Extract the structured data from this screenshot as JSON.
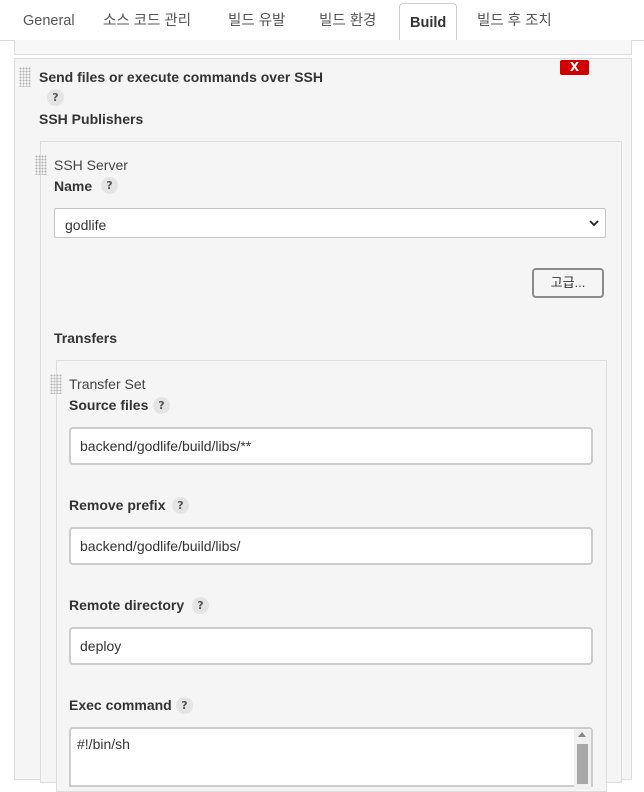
{
  "tabs": [
    {
      "label": "General",
      "active": false
    },
    {
      "label": "소스 코드 관리",
      "active": false
    },
    {
      "label": "빌드 유발",
      "active": false
    },
    {
      "label": "빌드 환경",
      "active": false
    },
    {
      "label": "Build",
      "active": true
    },
    {
      "label": "빌드 후 조치",
      "active": false
    }
  ],
  "builder": {
    "title": "Send files or execute commands over SSH",
    "delete_label": "X",
    "help_label": "?",
    "publishers_label": "SSH Publishers"
  },
  "server": {
    "section_label": "SSH Server",
    "name_label": "Name",
    "name_value": "godlife",
    "advanced_button": "고급...",
    "transfers_label": "Transfers"
  },
  "transfer_set": {
    "section_label": "Transfer Set",
    "source_files_label": "Source files",
    "source_files_value": "backend/godlife/build/libs/**",
    "remove_prefix_label": "Remove prefix",
    "remove_prefix_value": "backend/godlife/build/libs/",
    "remote_directory_label": "Remote directory",
    "remote_directory_value": "deploy",
    "exec_command_label": "Exec command",
    "exec_command_value": "#!/bin/sh"
  },
  "colors": {
    "delete_red": "#d00000",
    "panel_bg": "#f5f5f5"
  }
}
